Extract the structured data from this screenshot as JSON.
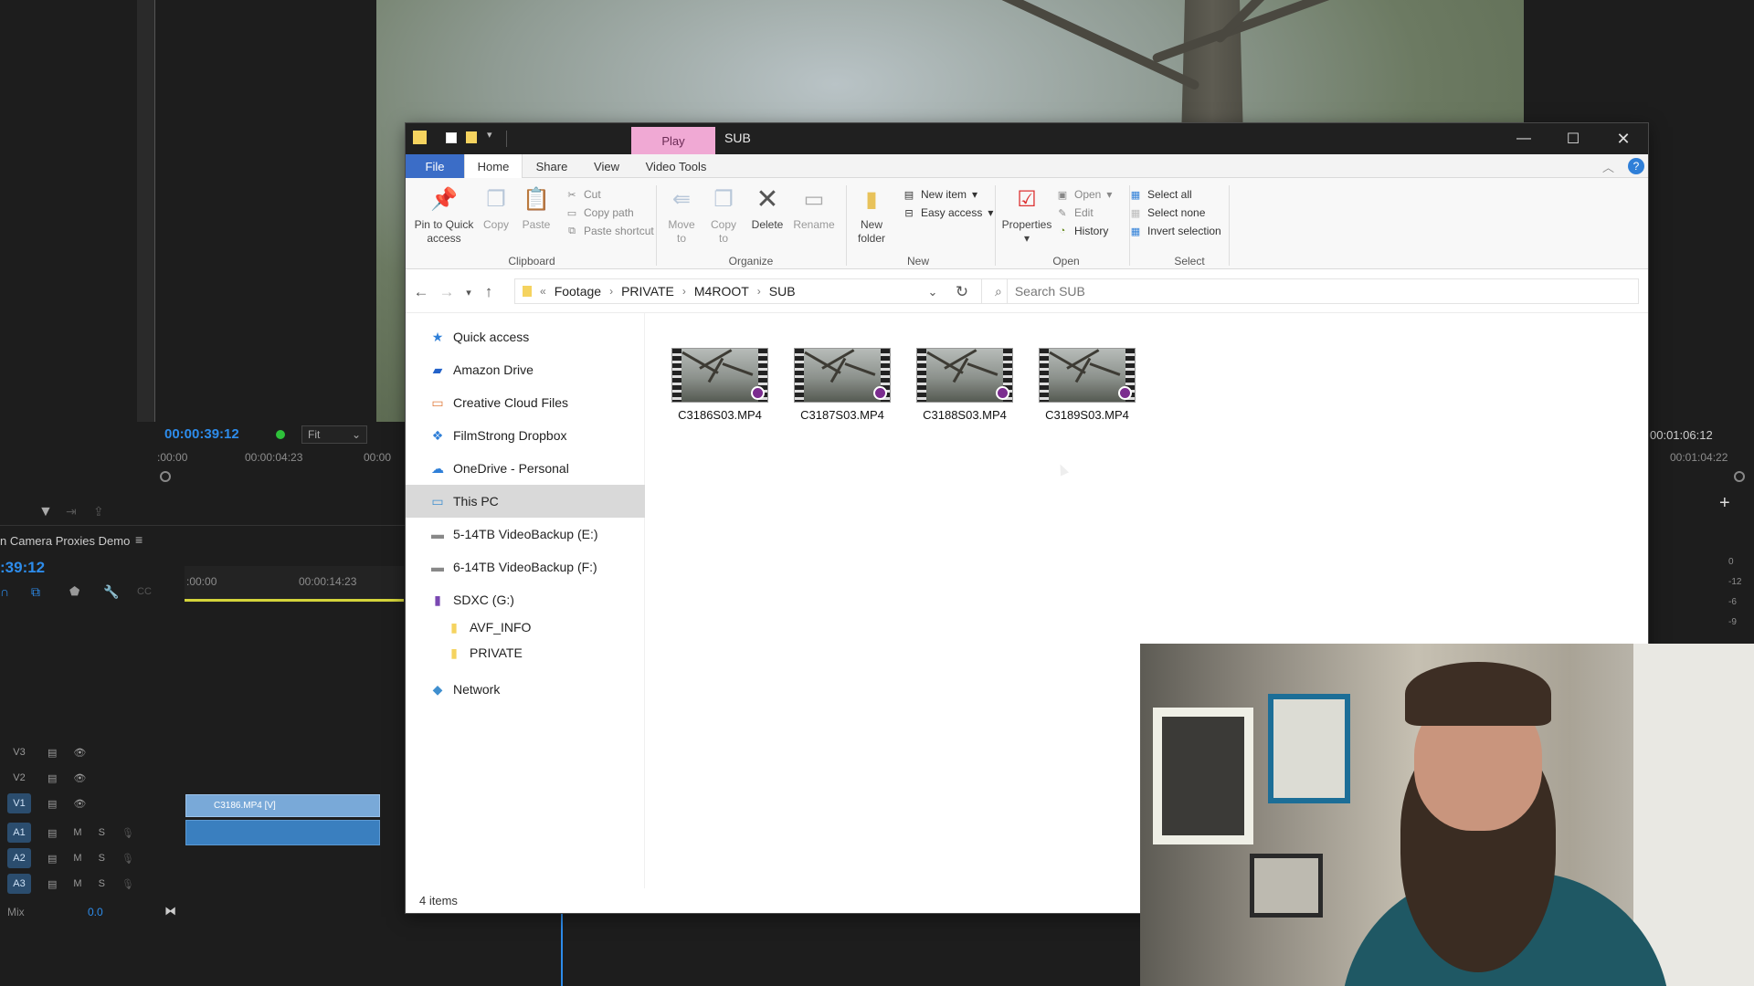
{
  "premiere": {
    "program_timecode": "00:00:39:12",
    "program_zoom": "Fit",
    "ruler_start": ":00:00",
    "ruler_mid": "00:00:04:23",
    "ruler_cut": "00:00",
    "program_duration": "00:01:06:12",
    "ruler_end": "00:01:04:22",
    "sequence_name": "n Camera Proxies Demo",
    "sequence_timecode": ":39:12",
    "seq_ruler_start": ":00:00",
    "seq_ruler_mid": "00:00:14:23",
    "tracks": [
      {
        "id": "V3",
        "m": "",
        "s": ""
      },
      {
        "id": "V2",
        "m": "",
        "s": ""
      },
      {
        "id": "V1",
        "m": "",
        "s": ""
      },
      {
        "id": "A1",
        "m": "M",
        "s": "S"
      },
      {
        "id": "A2",
        "m": "M",
        "s": "S"
      },
      {
        "id": "A3",
        "m": "M",
        "s": "S"
      }
    ],
    "mix_label": "Mix",
    "mix_value": "0.0",
    "clip_label": "C3186.MP4 [V]",
    "meter_labels": [
      "0",
      "-12",
      "-6",
      "-9"
    ]
  },
  "explorer": {
    "title": "SUB",
    "context_tab": "Play",
    "menu_tabs": [
      "File",
      "Home",
      "Share",
      "View",
      "Video Tools"
    ],
    "ribbon": {
      "clipboard": {
        "label": "Clipboard",
        "pin": "Pin to Quick",
        "pin2": "access",
        "copy": "Copy",
        "paste": "Paste",
        "cut": "Cut",
        "copy_path": "Copy path",
        "paste_shortcut": "Paste shortcut"
      },
      "organize": {
        "label": "Organize",
        "move": "Move",
        "move2": "to",
        "copy": "Copy",
        "copy2": "to",
        "delete": "Delete",
        "rename": "Rename"
      },
      "new": {
        "label": "New",
        "folder": "New",
        "folder2": "folder",
        "new_item": "New item",
        "easy_access": "Easy access"
      },
      "open": {
        "label": "Open",
        "properties": "Properties",
        "open": "Open",
        "edit": "Edit",
        "history": "History"
      },
      "select": {
        "label": "Select",
        "select_all": "Select all",
        "select_none": "Select none",
        "invert": "Invert selection"
      }
    },
    "breadcrumb": [
      "Footage",
      "PRIVATE",
      "M4ROOT",
      "SUB"
    ],
    "search_placeholder": "Search SUB",
    "nav": [
      {
        "label": "Quick access",
        "icon": "star-icon"
      },
      {
        "label": "Amazon Drive",
        "icon": "amazon-drive-icon"
      },
      {
        "label": "Creative Cloud Files",
        "icon": "creative-cloud-icon"
      },
      {
        "label": "FilmStrong Dropbox",
        "icon": "dropbox-icon"
      },
      {
        "label": "OneDrive - Personal",
        "icon": "onedrive-icon"
      },
      {
        "label": "This PC",
        "icon": "pc-icon"
      },
      {
        "label": "5-14TB VideoBackup (E:)",
        "icon": "drive-icon"
      },
      {
        "label": "6-14TB VideoBackup (F:)",
        "icon": "drive-icon"
      },
      {
        "label": "SDXC (G:)",
        "icon": "sd-card-icon"
      },
      {
        "label": "AVF_INFO",
        "icon": "folder-icon"
      },
      {
        "label": "PRIVATE",
        "icon": "folder-icon"
      },
      {
        "label": "Network",
        "icon": "network-icon"
      }
    ],
    "files": [
      "C3186S03.MP4",
      "C3187S03.MP4",
      "C3188S03.MP4",
      "C3189S03.MP4"
    ],
    "status": "4 items"
  }
}
